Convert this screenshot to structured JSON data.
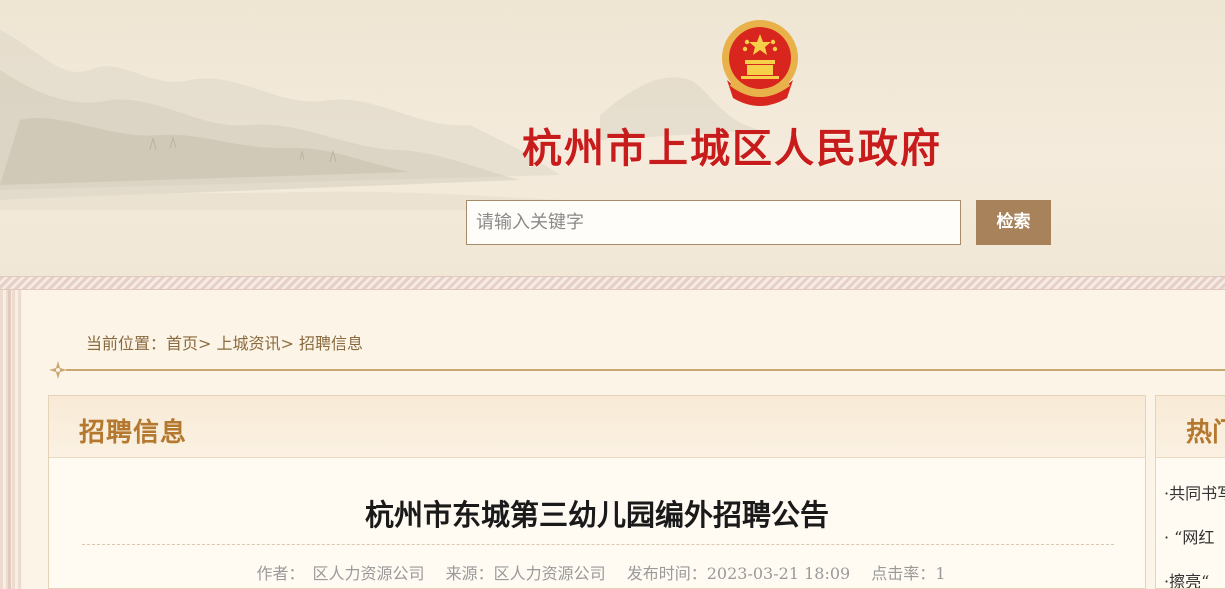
{
  "header": {
    "site_title": "杭州市上城区人民政府",
    "emblem_icon": "national-emblem-icon",
    "search": {
      "placeholder": "请输入关键字",
      "button_label": "检索"
    }
  },
  "breadcrumb": {
    "prefix": "当前位置：",
    "items": [
      "首页",
      "上城资讯",
      "招聘信息"
    ],
    "separator": ">"
  },
  "main": {
    "section_title": "招聘信息",
    "article": {
      "title": "杭州市东城第三幼儿园编外招聘公告",
      "author_label": "作者：",
      "author": "区人力资源公司",
      "source_label": "来源：",
      "source": "区人力资源公司",
      "published_label": "发布时间：",
      "published": "2023-03-21 18:09",
      "clicks_label": "点击率：",
      "clicks": "1"
    }
  },
  "sidebar": {
    "title": "热门",
    "items": [
      "·共同书写",
      "· “网红",
      "·擦亮“"
    ]
  },
  "colors": {
    "title_red": "#c81b1b",
    "accent_brown": "#a8825a",
    "section_gold": "#b4782f",
    "background": "#fbf4e7"
  }
}
